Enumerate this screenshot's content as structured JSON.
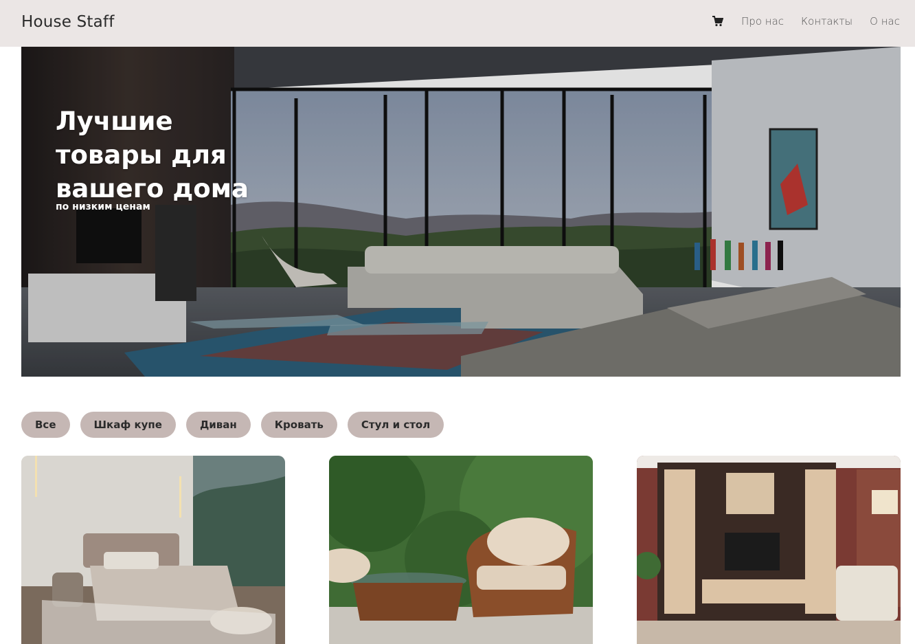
{
  "header": {
    "logo": "House Staff",
    "cart_icon": "cart-icon",
    "nav": [
      "Про нас",
      "Контакты",
      "О нас"
    ]
  },
  "hero": {
    "title": "Лучшие товары для вашего дома",
    "subtitle": "по низким ценам"
  },
  "filters": [
    "Все",
    "Шкаф купе",
    "Диван",
    "Кровать",
    "Стул и стол"
  ],
  "products": [
    {
      "image": "bedroom-photo"
    },
    {
      "image": "rattan-garden-furniture-photo"
    },
    {
      "image": "living-room-wall-unit-photo"
    }
  ],
  "colors": {
    "header_bg": "#ebe6e5",
    "chip_bg": "#c5b7b4",
    "text_dark": "#2b2b2b"
  }
}
